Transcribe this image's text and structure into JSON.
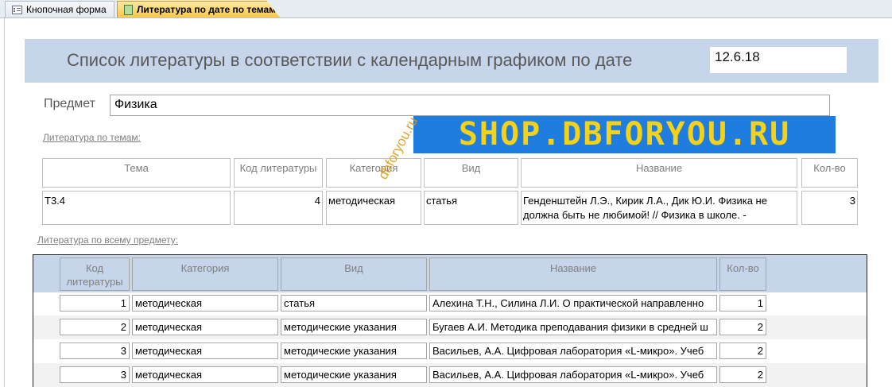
{
  "tabs": [
    {
      "label": "Кнопочная форма",
      "icon": "form-icon",
      "active": false
    },
    {
      "label": "Литература по дате по темам",
      "icon": "report-icon",
      "active": true
    }
  ],
  "header": {
    "title": "Список литературы в соответствии с календарным графиком по дате",
    "date": "12.6.18"
  },
  "subject": {
    "label": "Предмет",
    "value": "Физика"
  },
  "watermark": {
    "banner": "SHOP.DBFORYOU.RU",
    "diagonal": "dbforyou.ru"
  },
  "themes_section": {
    "label": "Литература по темам:",
    "headers": {
      "topic": "Тема",
      "code": "Код литературы",
      "category": "Категория",
      "type": "Вид",
      "title": "Название",
      "qty": "Кол-во"
    },
    "rows": [
      {
        "topic": "Т3.4",
        "code": "4",
        "category": "методическая",
        "type": "статья",
        "title": "Генденштейн Л.Э., Кирик Л.А., Дик Ю.И. Физика не должна быть не любимой! // Физика в школе. -",
        "qty": "3"
      }
    ]
  },
  "subject_section": {
    "label": "Литература по всему предмету:",
    "headers": {
      "code": "Код литературы",
      "category": "Категория",
      "type": "Вид",
      "title": "Название",
      "qty": "Кол-во"
    },
    "rows": [
      {
        "code": "1",
        "category": "методическая",
        "type": "статья",
        "title": "Алехина Т.Н., Силина Л.И. О практической направленно",
        "qty": "1"
      },
      {
        "code": "2",
        "category": "методическая",
        "type": "методические указания",
        "title": "Бугаев А.И. Методика преподавания физики в средней ш",
        "qty": "2"
      },
      {
        "code": "3",
        "category": "методическая",
        "type": "методические указания",
        "title": "Васильев, А.А. Цифровая лаборатория «L-микро». Учеб",
        "qty": "2"
      },
      {
        "code": "3",
        "category": "методическая",
        "type": "методические указания",
        "title": "Васильев, А.А. Цифровая лаборатория «L-микро». Учеб",
        "qty": "2"
      }
    ]
  }
}
